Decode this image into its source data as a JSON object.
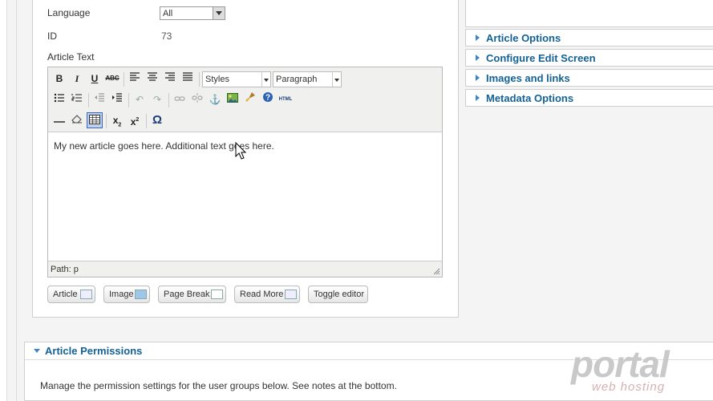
{
  "form": {
    "language_label": "Language",
    "language_value": "All",
    "id_label": "ID",
    "id_value": "73",
    "article_text_label": "Article Text"
  },
  "editor": {
    "styles_value": "Styles",
    "format_value": "Paragraph",
    "content": "My new article goes here. Additional text goes here.",
    "path": "Path: p",
    "html_label": "HTML",
    "toolbar_icons": [
      "bold-icon",
      "italic-icon",
      "underline-icon",
      "strikethrough-icon",
      "align-left-icon",
      "align-center-icon",
      "align-right-icon",
      "align-justify-icon",
      "bullet-list-icon",
      "numbered-list-icon",
      "outdent-icon",
      "indent-icon",
      "undo-icon",
      "redo-icon",
      "link-icon",
      "unlink-icon",
      "anchor-icon",
      "insert-image-icon",
      "cleanup-icon",
      "help-icon",
      "html-source-icon",
      "horizontal-rule-icon",
      "remove-format-icon",
      "insert-table-icon",
      "subscript-icon",
      "superscript-icon",
      "special-char-icon"
    ]
  },
  "editor_buttons": {
    "article": "Article",
    "image": "Image",
    "page_break": "Page Break",
    "read_more": "Read More",
    "toggle_editor": "Toggle editor"
  },
  "sidebar": {
    "panels": [
      {
        "label": "Article Options"
      },
      {
        "label": "Configure Edit Screen"
      },
      {
        "label": "Images and links"
      },
      {
        "label": "Metadata Options"
      }
    ]
  },
  "permissions": {
    "title": "Article Permissions",
    "note": "Manage the permission settings for the user groups below. See notes at the bottom."
  },
  "watermark": {
    "brand": "portal",
    "sub": "web hosting"
  },
  "colors": {
    "accent": "#146295",
    "triangle": "#3d85c6"
  }
}
